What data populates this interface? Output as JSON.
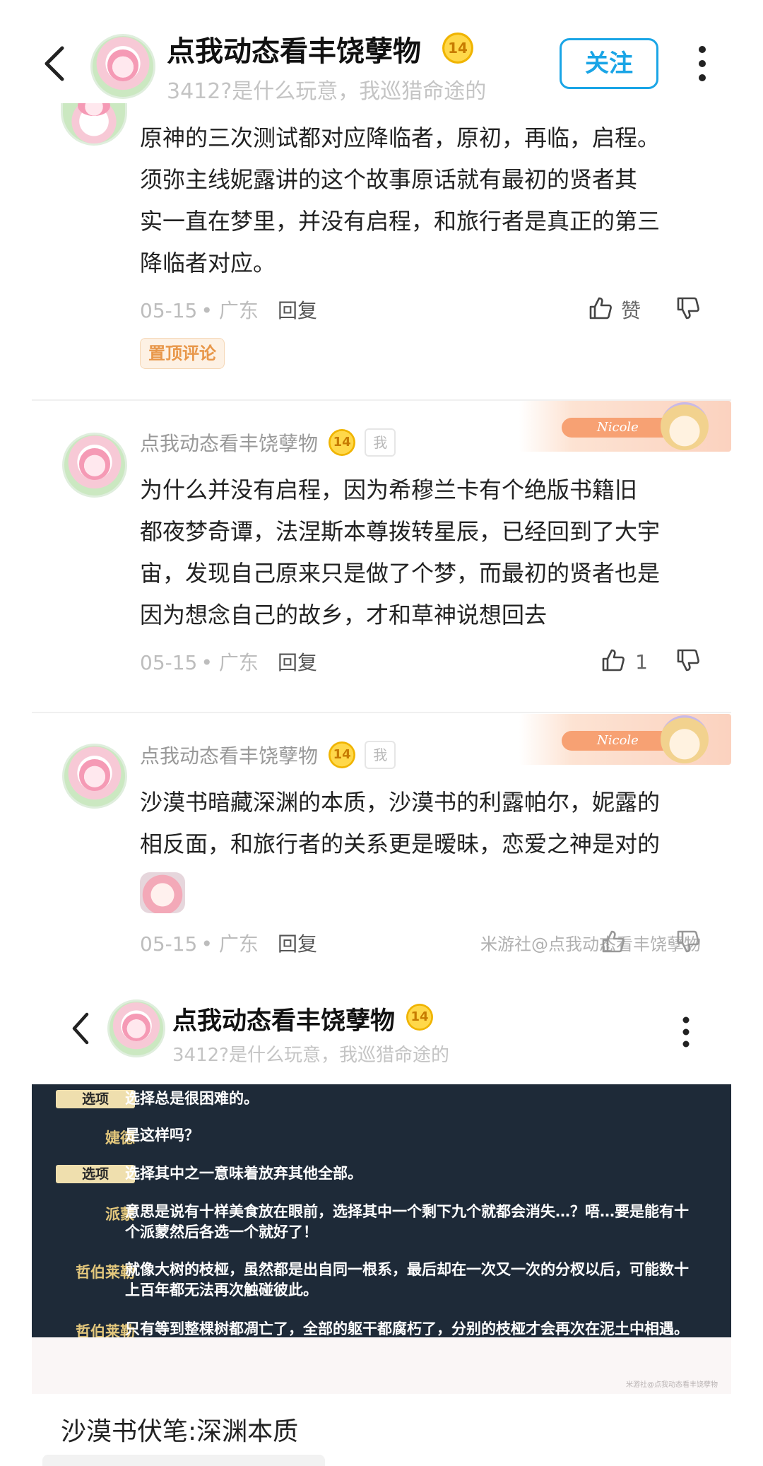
{
  "header": {
    "title": "点我动态看丰饶孽物",
    "level": "14",
    "subtitle": "3412?是什么玩意，我巡猎命途的",
    "follow_label": "关注"
  },
  "first_comment": {
    "lines": [
      "原神的三次测试都对应降临者，原初，再临，启程。",
      "须弥主线妮露讲的这个故事原话就有最初的贤者其",
      "实一直在梦里，并没有启程，和旅行者是真正的第三",
      "降临者对应。"
    ],
    "date": "05-15",
    "location": "广东",
    "reply": "回复",
    "like_label": "赞",
    "pinned_tag": "置顶评论"
  },
  "reply_1": {
    "author": "点我动态看丰饶孽物",
    "level": "14",
    "me_tag": "我",
    "banner_text": "Nicole",
    "lines": [
      "为什么并没有启程，因为希穆兰卡有个绝版书籍旧",
      "都夜梦奇谭，法涅斯本尊拨转星辰，已经回到了大宇",
      "宙，发现自己原来只是做了个梦，而最初的贤者也是",
      "因为想念自己的故乡，才和草神说想回去"
    ],
    "date": "05-15",
    "location": "广东",
    "reply": "回复",
    "like_count": "1"
  },
  "reply_2": {
    "author": "点我动态看丰饶孽物",
    "level": "14",
    "me_tag": "我",
    "banner_text": "Nicole",
    "lines": [
      "沙漠书暗藏深渊的本质，沙漠书的利露帕尔，妮露的",
      "相反面，和旅行者的关系更是暧昧，恋爱之神是对的"
    ],
    "date": "05-15",
    "location": "广东",
    "reply": "回复",
    "watermark": "米游社@点我动态看丰饶孽物"
  },
  "embedded_header": {
    "title": "点我动态看丰饶孽物",
    "level": "14",
    "subtitle": "3412?是什么玩意，我巡猎命途的"
  },
  "game_dialogue": [
    {
      "speaker": "选项",
      "is_option": true,
      "text": [
        "选择总是很困难的。"
      ]
    },
    {
      "speaker": "婕德",
      "is_option": false,
      "text": [
        "是这样吗？"
      ]
    },
    {
      "speaker": "选项",
      "is_option": true,
      "text": [
        "选择其中之一意味着放弃其他全部。"
      ]
    },
    {
      "speaker": "派蒙",
      "is_option": false,
      "text": [
        "意思是说有十样美食放在眼前，选择其中一个剩下九个就都会消失…？唔…要是能有十",
        "个派蒙然后各选一个就好了！"
      ]
    },
    {
      "speaker": "哲伯莱勒",
      "is_option": false,
      "text": [
        "就像大树的枝桠，虽然都是出自同一根系，最后却在一次又一次的分杈以后，可能数十",
        "上百年都无法再次触碰彼此。"
      ]
    },
    {
      "speaker": "哲伯莱勒",
      "is_option": false,
      "text": [
        "只有等到整棵树都凋亡了，全部的躯干都腐朽了，分别的枝桠才会再次在泥土中相遇。"
      ]
    }
  ],
  "image_watermark": "米游社@点我动态看丰饶孽物",
  "section_heading": "沙漠书伏笔:深渊本质",
  "colors": {
    "accent": "#1aa5e6",
    "pinned": "#e8974a",
    "game_bg": "#1e2a38"
  }
}
